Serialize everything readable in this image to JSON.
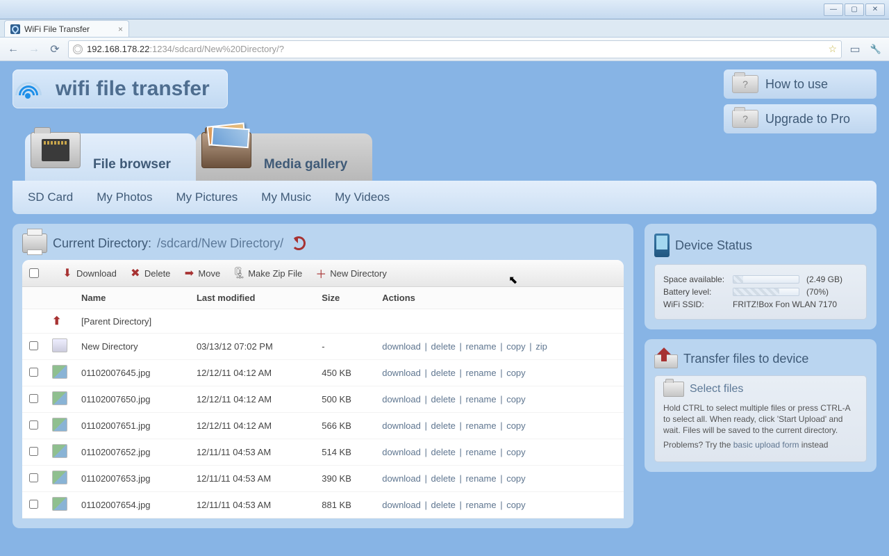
{
  "window": {
    "title": "WiFi File Transfer"
  },
  "browser": {
    "url": "192.168.178.22:1234/sdcard/New%20Directory/?",
    "url_host": "192.168.178.22",
    "url_rest": ":1234/sdcard/New%20Directory/?"
  },
  "header": {
    "logo_text": "wifi file transfer",
    "buttons": {
      "how_to_use": "How to use",
      "upgrade": "Upgrade to Pro"
    }
  },
  "main_tabs": {
    "file_browser": "File browser",
    "media_gallery": "Media gallery"
  },
  "sub_nav": [
    "SD Card",
    "My Photos",
    "My Pictures",
    "My Music",
    "My Videos"
  ],
  "directory": {
    "label": "Current Directory:",
    "path": "/sdcard/New Directory/"
  },
  "toolbar": {
    "download": "Download",
    "delete": "Delete",
    "move": "Move",
    "zip": "Make Zip File",
    "newdir": "New Directory"
  },
  "columns": {
    "name": "Name",
    "modified": "Last modified",
    "size": "Size",
    "actions": "Actions"
  },
  "parent": "[Parent Directory]",
  "action_labels": {
    "download": "download",
    "delete": "delete",
    "rename": "rename",
    "copy": "copy",
    "zip": "zip"
  },
  "files": [
    {
      "icon": "folder",
      "name": "New Directory",
      "modified": "03/13/12 07:02 PM",
      "size": "-",
      "actions": [
        "download",
        "delete",
        "rename",
        "copy",
        "zip"
      ]
    },
    {
      "icon": "img",
      "name": "01102007645.jpg",
      "modified": "12/12/11 04:12 AM",
      "size": "450 KB",
      "actions": [
        "download",
        "delete",
        "rename",
        "copy"
      ]
    },
    {
      "icon": "img",
      "name": "01102007650.jpg",
      "modified": "12/12/11 04:12 AM",
      "size": "500 KB",
      "actions": [
        "download",
        "delete",
        "rename",
        "copy"
      ]
    },
    {
      "icon": "img",
      "name": "01102007651.jpg",
      "modified": "12/12/11 04:12 AM",
      "size": "566 KB",
      "actions": [
        "download",
        "delete",
        "rename",
        "copy"
      ]
    },
    {
      "icon": "img",
      "name": "01102007652.jpg",
      "modified": "12/11/11 04:53 AM",
      "size": "514 KB",
      "actions": [
        "download",
        "delete",
        "rename",
        "copy"
      ]
    },
    {
      "icon": "img",
      "name": "01102007653.jpg",
      "modified": "12/11/11 04:53 AM",
      "size": "390 KB",
      "actions": [
        "download",
        "delete",
        "rename",
        "copy"
      ]
    },
    {
      "icon": "img",
      "name": "01102007654.jpg",
      "modified": "12/11/11 04:53 AM",
      "size": "881 KB",
      "actions": [
        "download",
        "delete",
        "rename",
        "copy"
      ]
    }
  ],
  "status": {
    "title": "Device Status",
    "space_label": "Space available:",
    "space_pct": 15,
    "space_val": "(2.49 GB)",
    "batt_label": "Battery level:",
    "batt_pct": 70,
    "batt_val": "(70%)",
    "ssid_label": "WiFi SSID:",
    "ssid_val": "FRITZ!Box Fon WLAN 7170"
  },
  "upload": {
    "title": "Transfer files to device",
    "select_title": "Select files",
    "help1": "Hold CTRL to select multiple files or press CTRL-A to select all. When ready, click 'Start Upload' and wait. Files will be saved to the current directory.",
    "help2_pre": "Problems? Try the ",
    "help2_link": "basic upload form",
    "help2_post": " instead"
  }
}
